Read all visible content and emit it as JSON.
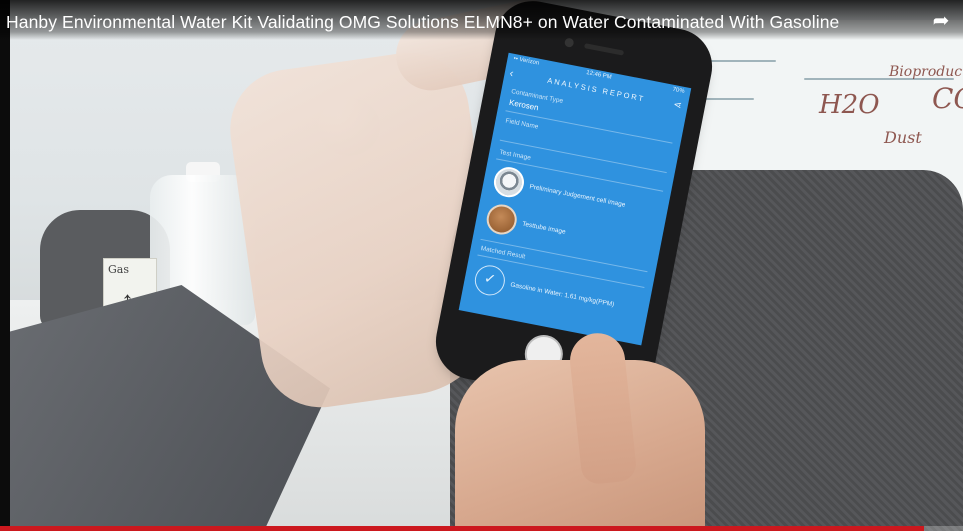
{
  "player": {
    "video_title": "Hanby Environmental Water Kit Validating OMG Solutions ELMN8+ on Water Contaminated With Gasoline",
    "share_icon": "share-arrow-icon",
    "progress_fraction": 0.96,
    "progress_color": "#cc181e"
  },
  "scene": {
    "box_label": "Gas",
    "whiteboard": {
      "text_1": "H2O",
      "text_2": "Bioproducts",
      "text_3": "Dust",
      "text_4": "CO"
    }
  },
  "phone_app": {
    "status": {
      "carrier": "•• Verizon",
      "time": "12:46 PM",
      "battery": "70%"
    },
    "header": {
      "title": "ANALYSIS REPORT",
      "back_icon": "back-chevron-icon",
      "share_icon": "share-icon"
    },
    "fields": [
      {
        "label": "Contaminant Type",
        "value": "Kerosen"
      },
      {
        "label": "Field Name",
        "value": ""
      }
    ],
    "test_images": {
      "label": "Test Image",
      "items": [
        {
          "icon": "judgement-cell-thumbnail",
          "text": "Preliminary Judgement cell image"
        },
        {
          "icon": "testtube-thumbnail",
          "text": "Testtube image"
        }
      ]
    },
    "result": {
      "label": "Matched Result",
      "text": "Gasoline in Water: 1.61 mg/kg(PPM)"
    },
    "accent_color": "#2f92df"
  }
}
